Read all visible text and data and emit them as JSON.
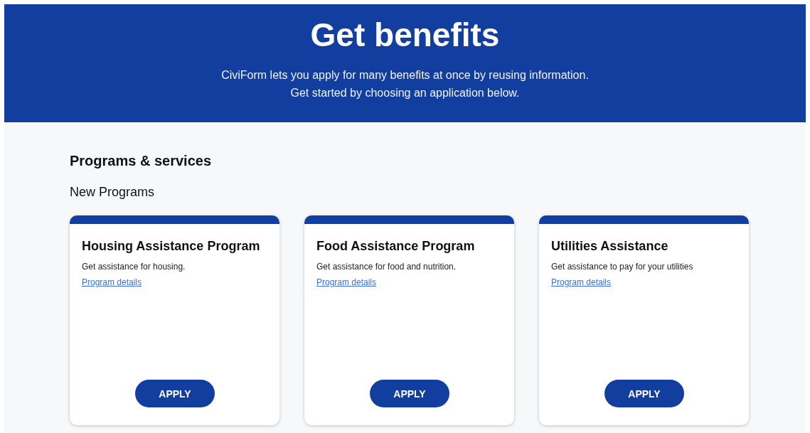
{
  "header": {
    "title": "Get benefits",
    "subtitle_lines": [
      "CiviForm lets you apply for many benefits at once by reusing information.",
      "Get started by choosing an application below."
    ]
  },
  "section": {
    "title": "Programs & services",
    "subtitle": "New Programs"
  },
  "programs": [
    {
      "title": "Housing Assistance Program",
      "description": "Get assistance for housing.",
      "link": "Program details",
      "button": "APPLY"
    },
    {
      "title": "Food Assistance Program",
      "description": "Get assistance for food and nutrition.",
      "link": "Program details",
      "button": "APPLY"
    },
    {
      "title": "Utilities Assistance",
      "description": "Get assistance to pay for your utilities",
      "link": "Program details",
      "button": "APPLY"
    }
  ]
}
